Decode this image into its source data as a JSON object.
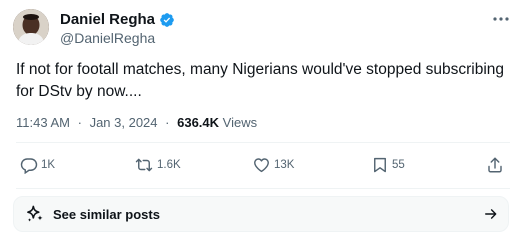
{
  "author": {
    "display_name": "Daniel Regha",
    "handle": "@DanielRegha",
    "verified": true
  },
  "tweet": {
    "text": "If not for footall matches, many Nigerians would've stopped subscribing for DStv by now....",
    "time": "11:43 AM",
    "separator": "·",
    "date": "Jan 3, 2024",
    "views_count": "636.4K",
    "views_label": "Views"
  },
  "actions": {
    "replies": "1K",
    "reposts": "1.6K",
    "likes": "13K",
    "bookmarks": "55"
  },
  "similar": {
    "label": "See similar posts"
  },
  "colors": {
    "text": "#0f1419",
    "muted": "#536471",
    "verified": "#1d9bf0",
    "divider": "#eff3f4"
  }
}
